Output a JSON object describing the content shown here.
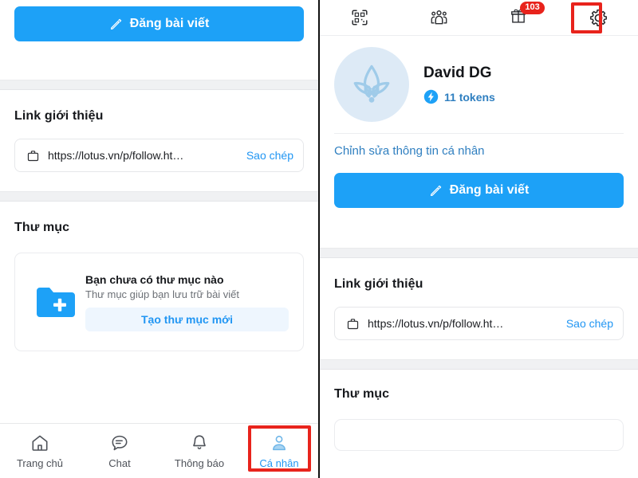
{
  "app": {
    "brand_blue": "#1da1f7",
    "link_blue": "#2196f3",
    "highlight_red": "#e8231c",
    "avatar_bg": "#ddeaf6"
  },
  "left_panel": {
    "post_button": {
      "label": "Đăng bài viết",
      "icon": "pencil-icon"
    },
    "link_section": {
      "title": "Link giới thiệu",
      "url": "https://lotus.vn/p/follow.ht…",
      "copy_label": "Sao chép",
      "icon": "briefcase-icon"
    },
    "folder_section": {
      "title": "Thư mục",
      "empty_title": "Bạn chưa có thư mục nào",
      "empty_sub": "Thư mục giúp bạn lưu trữ bài viết",
      "cta_label": "Tạo thư mục mới",
      "icon": "folder-plus-icon"
    },
    "bottom_nav": {
      "items": [
        {
          "label": "Trang chủ",
          "icon": "home-icon",
          "active": false
        },
        {
          "label": "Chat",
          "icon": "chat-bubble-icon",
          "active": false
        },
        {
          "label": "Thông báo",
          "icon": "bell-icon",
          "active": false
        },
        {
          "label": "Cá nhân",
          "icon": "person-icon",
          "active": true
        }
      ],
      "highlighted_item": "Cá nhân"
    }
  },
  "right_panel": {
    "topbar": {
      "items": [
        {
          "name": "qr-scan-icon",
          "label": ""
        },
        {
          "name": "people-group-icon",
          "label": ""
        },
        {
          "name": "gift-icon",
          "label": "",
          "badge": "103"
        },
        {
          "name": "gear-icon",
          "label": "",
          "highlighted": true
        }
      ]
    },
    "profile": {
      "avatar_icon": "lotus-logo-icon",
      "name": "David DG",
      "tokens_text": "11 tokens",
      "token_icon": "lightning-bolt-icon",
      "edit_link": "Chỉnh sửa thông tin cá nhân"
    },
    "post_button": {
      "label": "Đăng bài viết",
      "icon": "pencil-icon"
    },
    "link_section": {
      "title": "Link giới thiệu",
      "url": "https://lotus.vn/p/follow.ht…",
      "copy_label": "Sao chép",
      "icon": "briefcase-icon"
    },
    "folder_section": {
      "title": "Thư mục"
    }
  }
}
